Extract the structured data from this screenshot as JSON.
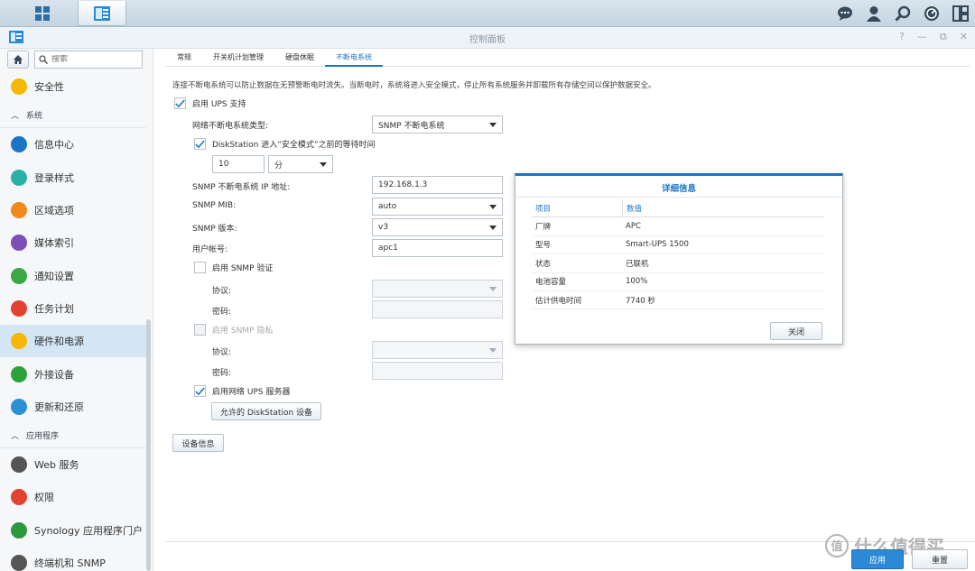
{
  "window": {
    "title": "控制面板"
  },
  "search": {
    "placeholder": "搜索"
  },
  "sidebar": {
    "items": [
      {
        "label": "安全性",
        "icon": "shield-icon",
        "color": "#f5b800",
        "type": "item"
      },
      {
        "label": "系统",
        "type": "section"
      },
      {
        "label": "信息中心",
        "icon": "info-icon",
        "color": "#1a75c4",
        "type": "item"
      },
      {
        "label": "登录样式",
        "icon": "palette-icon",
        "color": "#2bb0a8",
        "type": "item"
      },
      {
        "label": "区域选项",
        "icon": "calendar-globe-icon",
        "color": "#f08a1d",
        "type": "item"
      },
      {
        "label": "媒体索引",
        "icon": "media-index-icon",
        "color": "#7b4fb5",
        "type": "item"
      },
      {
        "label": "通知设置",
        "icon": "chat-bubble-icon",
        "color": "#3aa845",
        "type": "item"
      },
      {
        "label": "任务计划",
        "icon": "task-calendar-icon",
        "color": "#e2422f",
        "type": "item"
      },
      {
        "label": "硬件和电源",
        "icon": "lightbulb-icon",
        "color": "#f5b800",
        "type": "item",
        "active": true
      },
      {
        "label": "外接设备",
        "icon": "external-device-icon",
        "color": "#2aa33a",
        "type": "item"
      },
      {
        "label": "更新和还原",
        "icon": "update-restore-icon",
        "color": "#2a8fd6",
        "type": "item"
      },
      {
        "label": "应用程序",
        "type": "section"
      },
      {
        "label": "Web 服务",
        "icon": "web-service-icon",
        "color": "#555",
        "type": "item"
      },
      {
        "label": "权限",
        "icon": "privileges-icon",
        "color": "#e2422f",
        "type": "item"
      },
      {
        "label": "Synology 应用程序门户",
        "icon": "portal-icon",
        "color": "#2b9a3e",
        "type": "item"
      },
      {
        "label": "终端机和 SNMP",
        "icon": "terminal-icon",
        "color": "#555",
        "type": "item"
      }
    ]
  },
  "tabs": [
    {
      "label": "常规",
      "active": false
    },
    {
      "label": "开关机计划管理",
      "active": false
    },
    {
      "label": "硬盘休眠",
      "active": false
    },
    {
      "label": "不断电系统",
      "active": true
    }
  ],
  "ups": {
    "description": "连接不断电系统可以防止数据在无预警断电时流失。当断电时，系统将进入安全模式，停止所有系统服务并卸载所有存储空间以保护数据安全。",
    "enable_label": "启用 UPS 支持",
    "type_label": "网络不断电系统类型:",
    "type_value": "SNMP 不断电系统",
    "wait_label": "DiskStation 进入“安全模式”之前的等待时间",
    "wait_value": "10",
    "wait_unit": "分",
    "ip_label": "SNMP 不断电系统 IP 地址:",
    "ip_value": "192.168.1.3",
    "mib_label": "SNMP MIB:",
    "mib_value": "auto",
    "version_label": "SNMP 版本:",
    "version_value": "v3",
    "user_label": "用户帐号:",
    "user_value": "apc1",
    "auth_label": "启用 SNMP 验证",
    "auth_protocol_label": "协议:",
    "auth_password_label": "密码:",
    "privacy_label": "启用 SNMP 隐私",
    "privacy_protocol_label": "协议:",
    "privacy_password_label": "密码:",
    "server_label": "启用网络 UPS 服务器",
    "allowed_button": "允许的 DiskStation 设备",
    "device_info_button": "设备信息"
  },
  "dialog": {
    "title": "详细信息",
    "columns": [
      "项目",
      "数值"
    ],
    "rows": [
      [
        "厂牌",
        "APC"
      ],
      [
        "型号",
        "Smart-UPS 1500"
      ],
      [
        "状态",
        "已联机"
      ],
      [
        "电池容量",
        "100%"
      ],
      [
        "估计供电时间",
        "7740 秒"
      ]
    ],
    "close_button": "关闭"
  },
  "footer": {
    "apply": "应用",
    "reset": "重置"
  },
  "watermark": {
    "text": "什么值得买",
    "badge": "值"
  }
}
